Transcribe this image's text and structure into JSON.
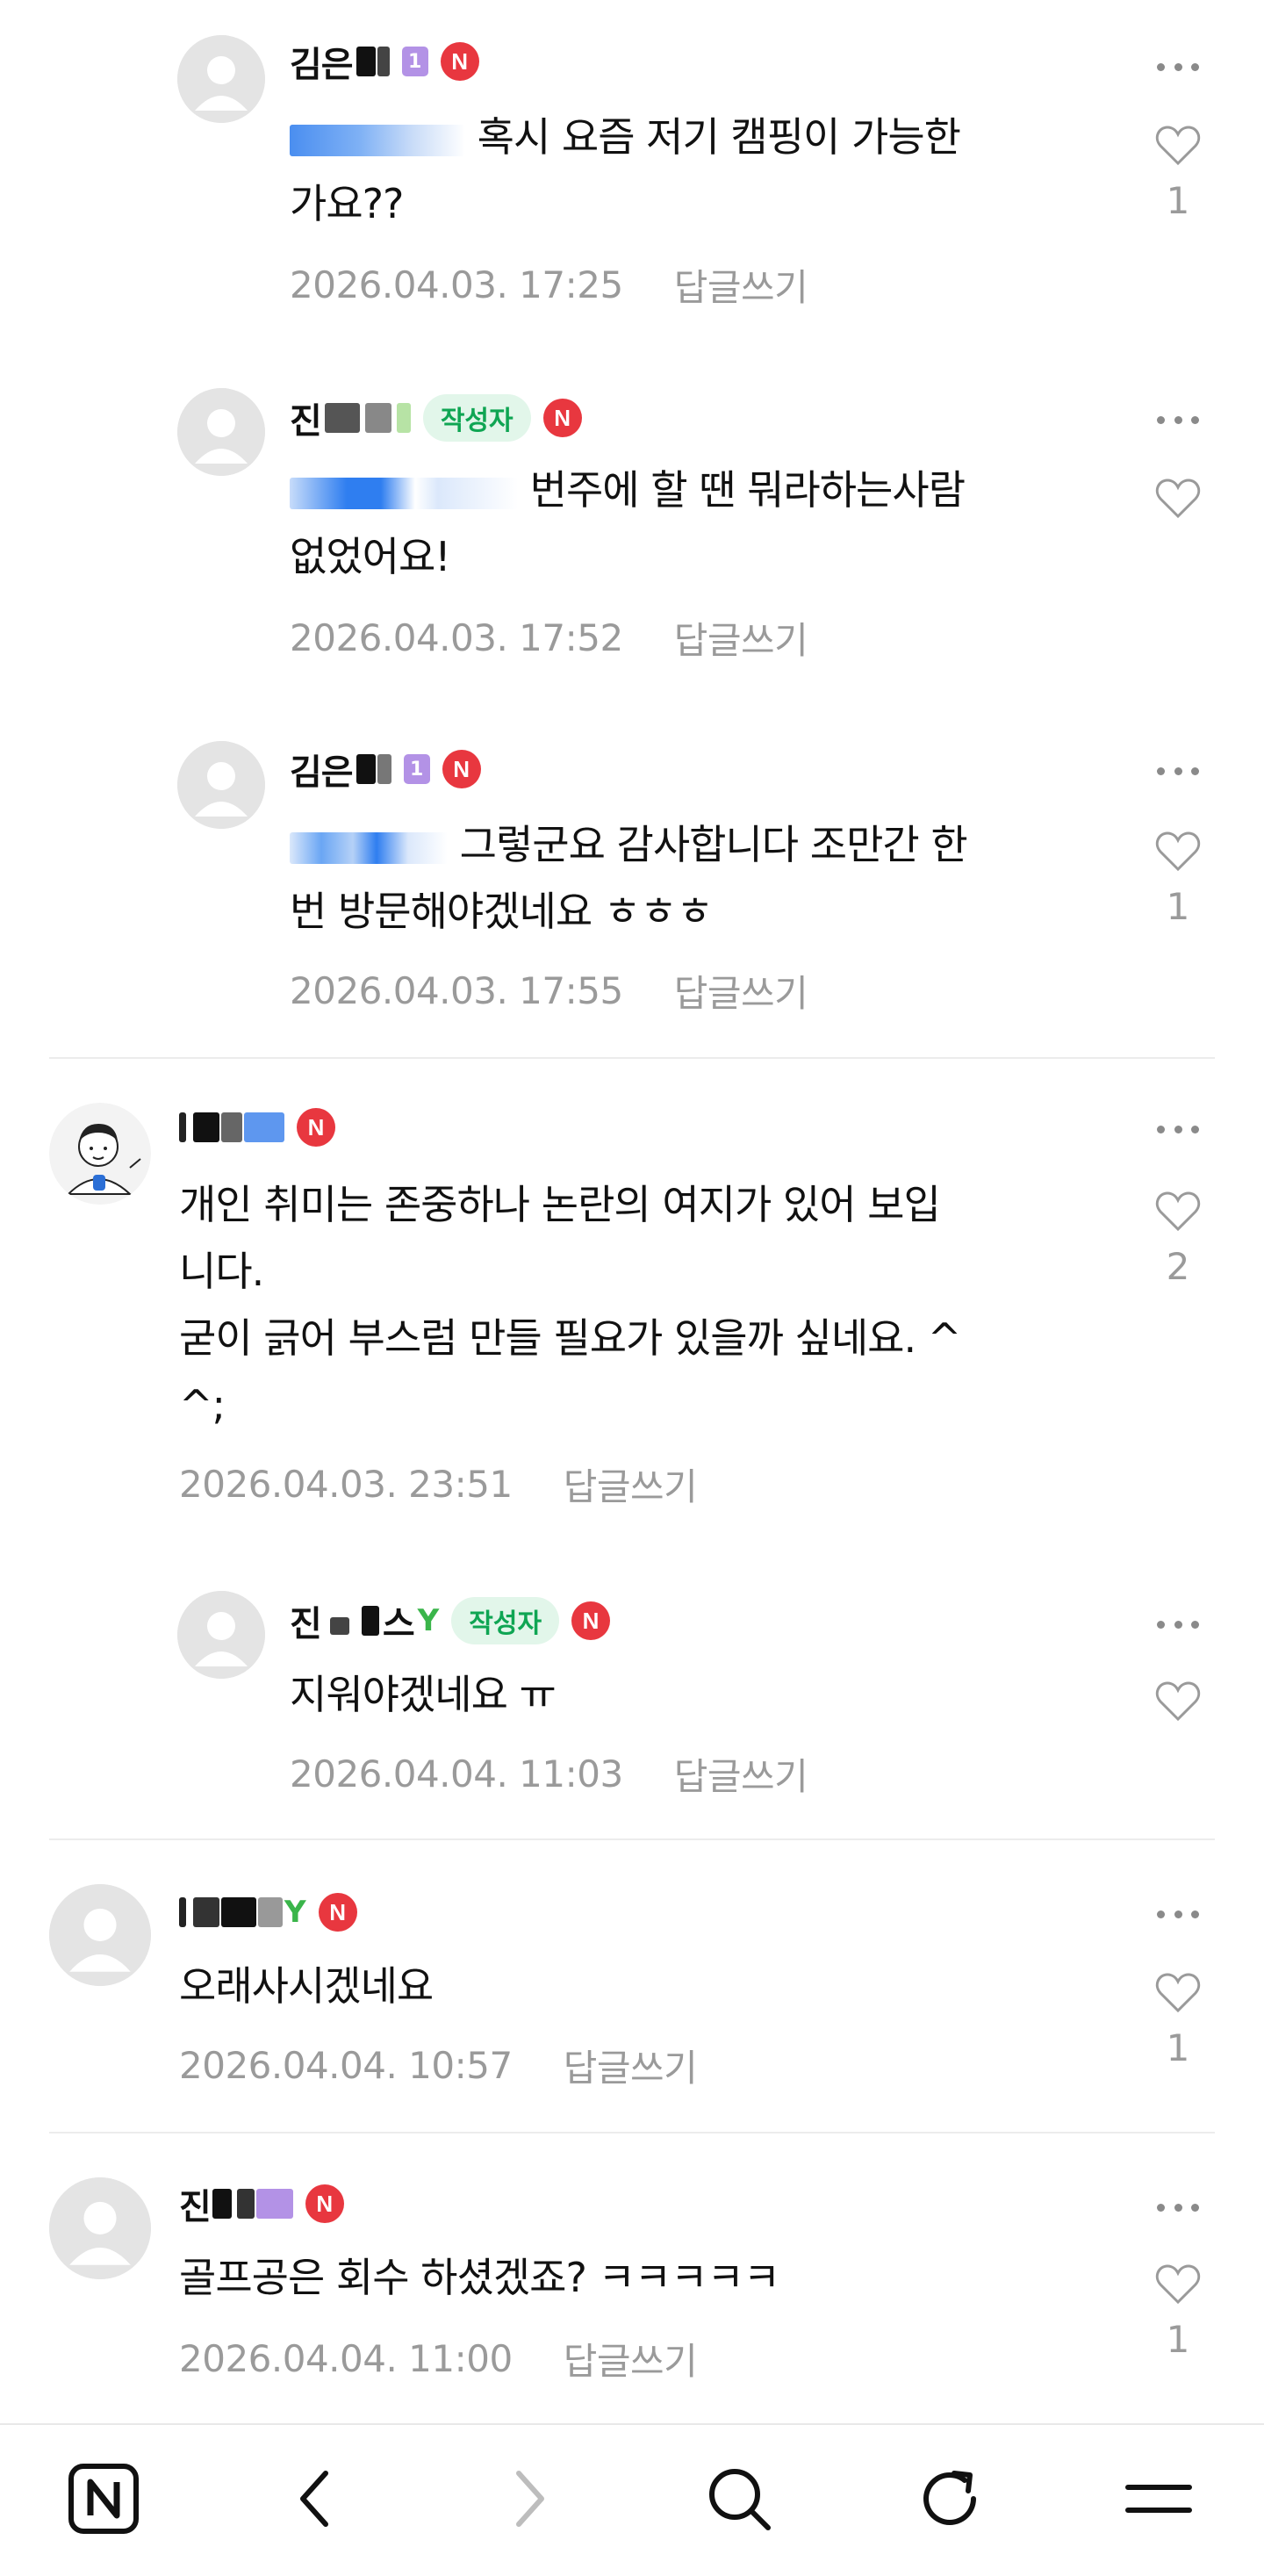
{
  "comments": [
    {
      "nickname": "김은",
      "text_line1": "혹시 요즘 저기 캠핑이 가능한",
      "text_line2": "가요??",
      "date": "2026.04.03. 17:25",
      "reply_label": "답글쓰기",
      "likes": "1"
    },
    {
      "nickname": "진",
      "author_badge": "작성자",
      "text_line1": "번주에 할 땐 뭐라하는사람",
      "text_line2": "없었어요!",
      "date": "2026.04.03. 17:52",
      "reply_label": "답글쓰기"
    },
    {
      "nickname": "김은",
      "text_line1": "그렇군요 감사합니다 조만간 한",
      "text_line2": "번 방문해야겠네요 ㅎㅎㅎ",
      "date": "2026.04.03. 17:55",
      "reply_label": "답글쓰기",
      "likes": "1"
    },
    {
      "text_line1": "개인 취미는 존중하나 논란의 여지가 있어 보입",
      "text_line2": "니다.",
      "text_line3": "굳이 긁어 부스럼 만들 필요가 있을까 싶네요. ^",
      "text_line4": "^;",
      "date": "2026.04.03. 23:51",
      "reply_label": "답글쓰기",
      "likes": "2"
    },
    {
      "nickname": "진",
      "nickname_tail": "스",
      "author_badge": "작성자",
      "text_line1": "지워야겠네요 ㅠ",
      "date": "2026.04.04. 11:03",
      "reply_label": "답글쓰기"
    },
    {
      "text_line1": "오래사시겠네요",
      "date": "2026.04.04. 10:57",
      "reply_label": "답글쓰기",
      "likes": "1"
    },
    {
      "nickname": "진",
      "text_line1": "골프공은 회수 하셨겠죠? ㅋㅋㅋㅋㅋ",
      "date": "2026.04.04. 11:00",
      "reply_label": "답글쓰기",
      "likes": "1"
    }
  ],
  "badges": {
    "naver_mark": "N",
    "level_mark": "1"
  },
  "icons": {
    "more": "more-dots-icon",
    "like": "heart-outline-icon",
    "nav": [
      "naver-home-icon",
      "back-arrow-icon",
      "forward-arrow-icon",
      "search-icon",
      "refresh-icon",
      "menu-icon"
    ]
  },
  "colors": {
    "accent_green": "#0fa553",
    "naver_red": "#e8373f",
    "muted": "#9a9a9a"
  }
}
